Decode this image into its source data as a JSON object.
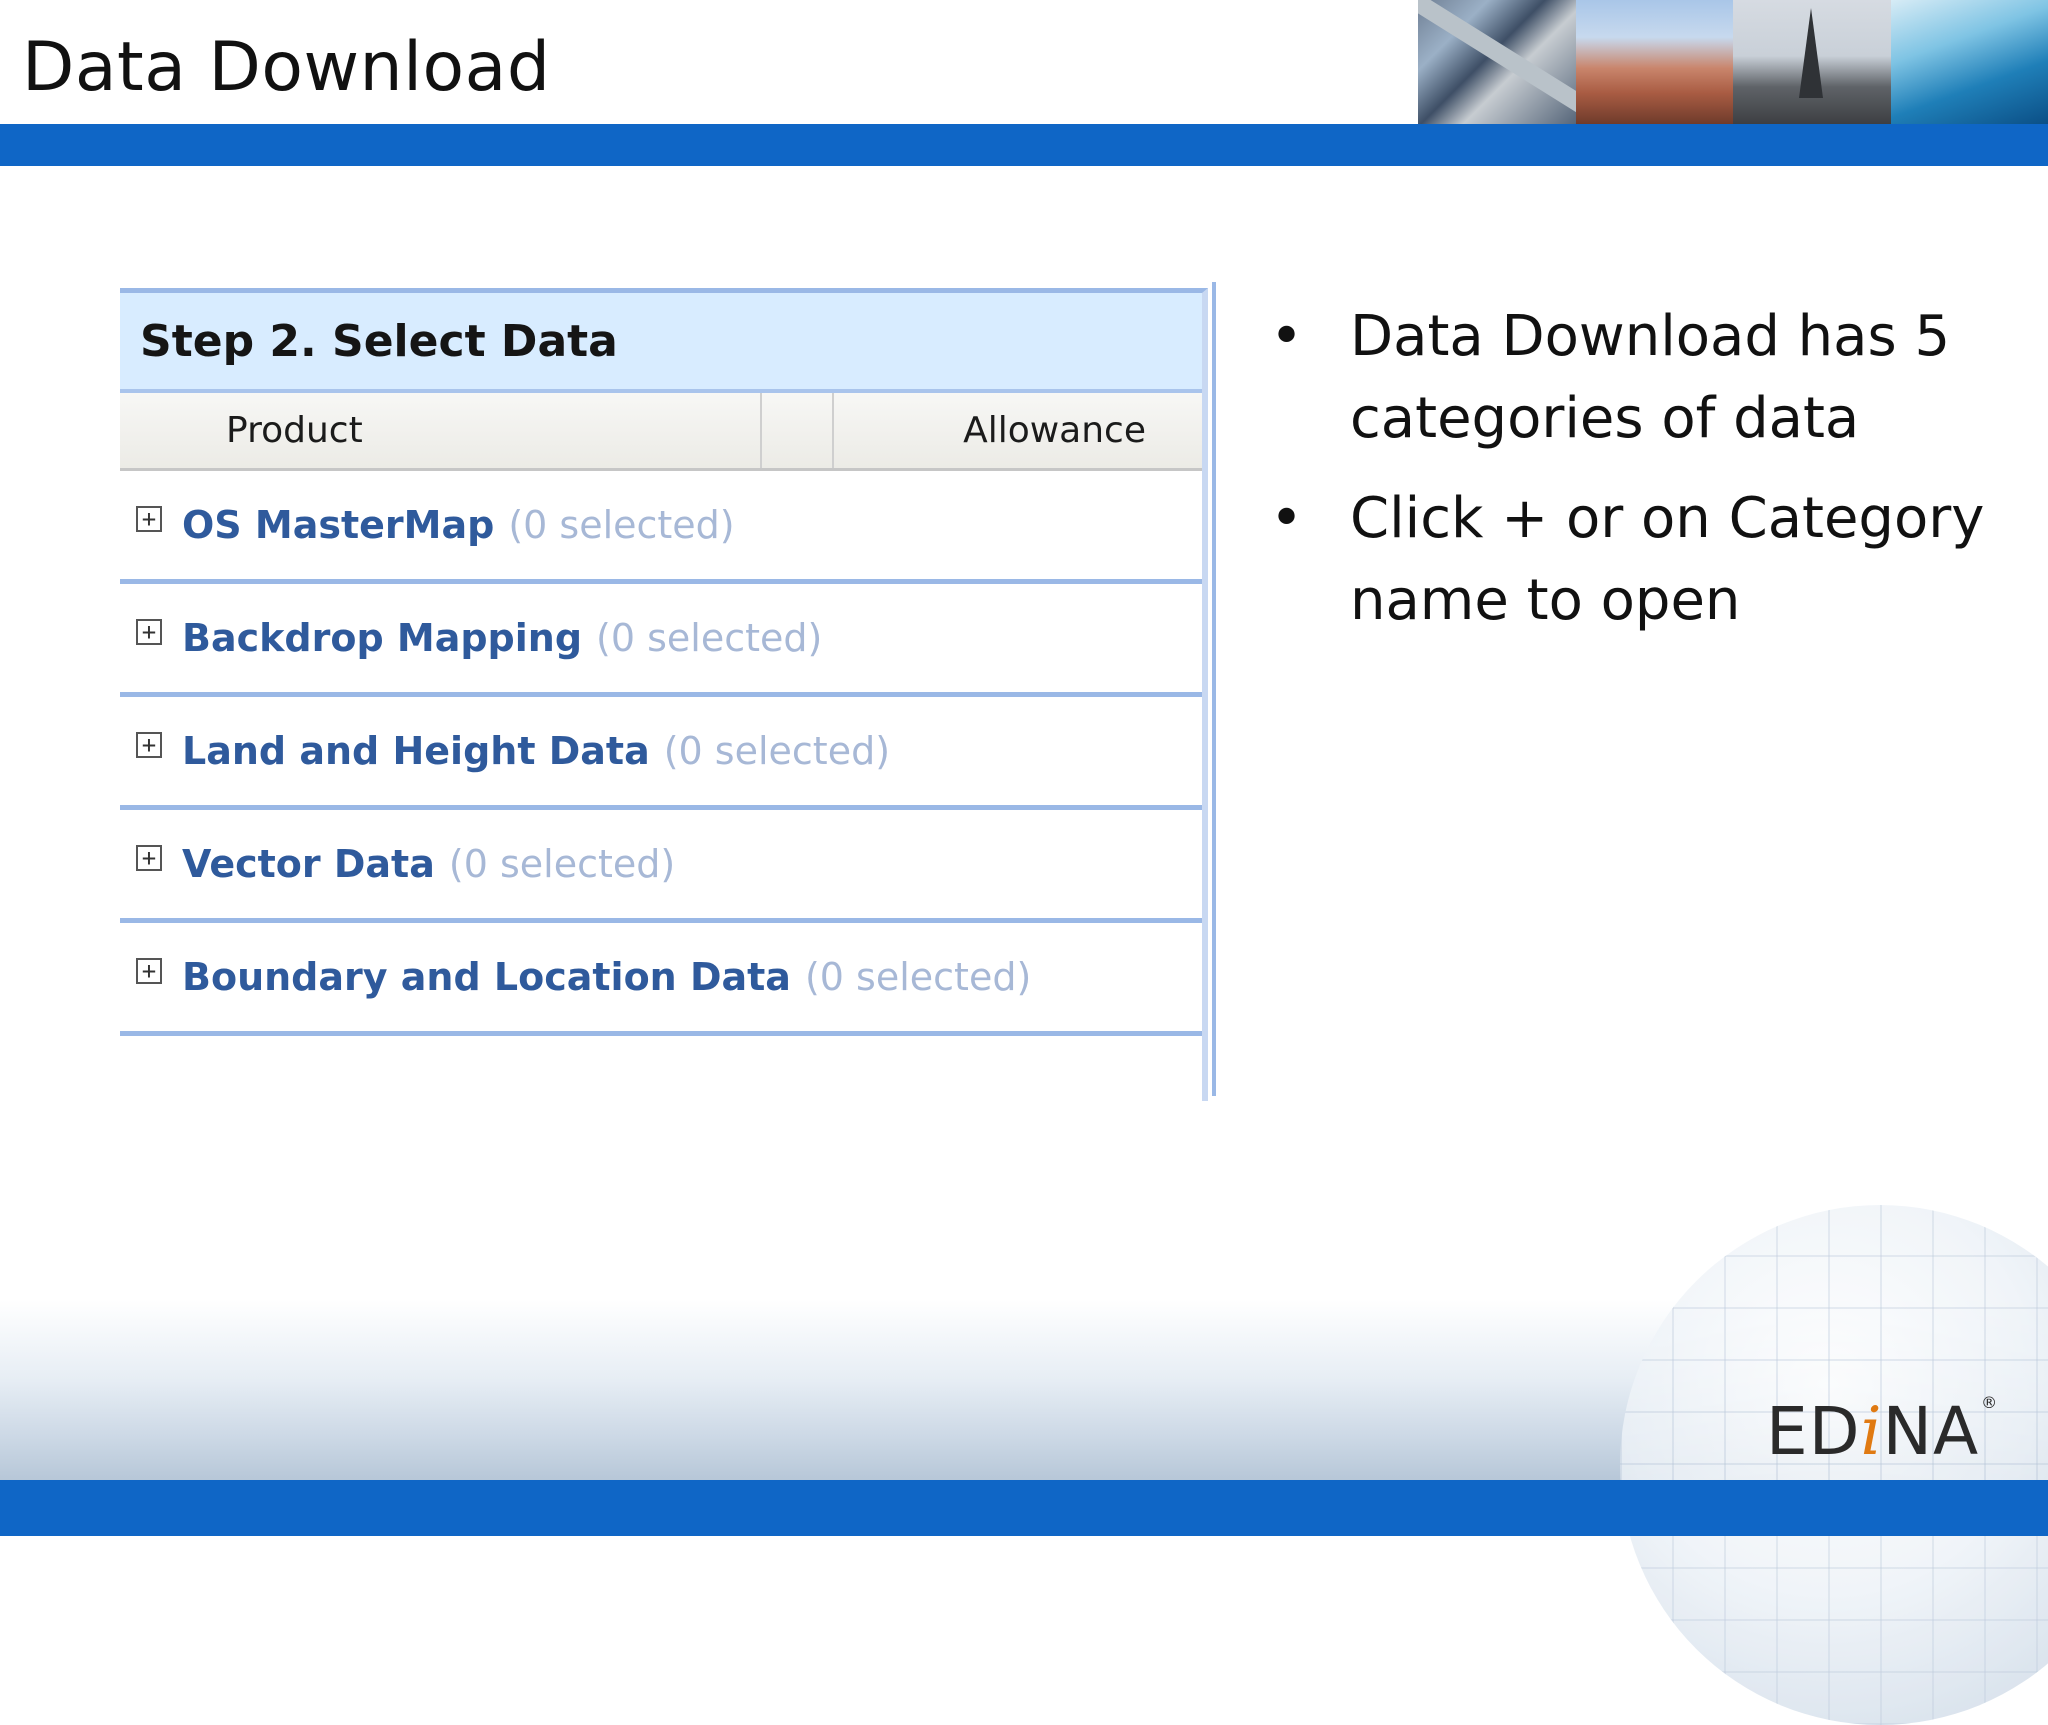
{
  "slide": {
    "title": "Data Download",
    "logo": "EDiNA"
  },
  "panel": {
    "heading": "Step 2. Select Data",
    "columns": {
      "product": "Product",
      "blank": "",
      "allowance": "Allowance"
    },
    "categories": [
      {
        "name": "OS MasterMap",
        "count": "(0 selected)"
      },
      {
        "name": "Backdrop Mapping",
        "count": "(0 selected)"
      },
      {
        "name": "Land and Height Data",
        "count": "(0 selected)"
      },
      {
        "name": "Vector Data",
        "count": "(0 selected)"
      },
      {
        "name": "Boundary and Location Data",
        "count": "(0 selected)"
      }
    ],
    "expand_glyph": "+"
  },
  "bullets": [
    "Data Download has 5 categories of data",
    "Click + or on Category name to open"
  ],
  "colors": {
    "brand_blue": "#0f66c6",
    "category_link": "#2f5a9c",
    "category_count": "#a7b8d6",
    "header_bg": "#d8ecff",
    "logo_accent": "#e07a12"
  }
}
